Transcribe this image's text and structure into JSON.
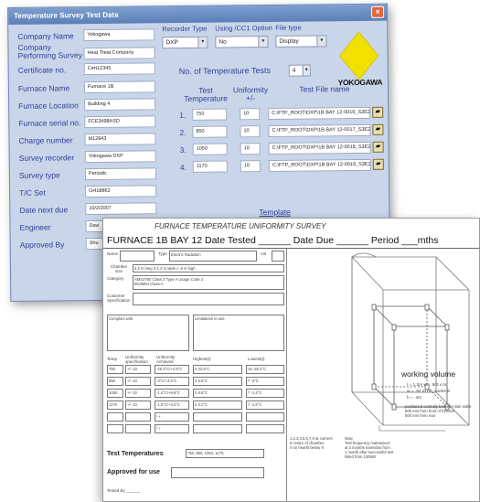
{
  "dialog": {
    "title": "Temperature Survey Test Data",
    "close_glyph": "×",
    "fields": [
      {
        "label": "Company Name",
        "value": "Yokogawa"
      },
      {
        "label": "Company\nPerforming Survey",
        "value": "Heat Treat Company"
      },
      {
        "label": "Certificate no.",
        "value": "Cert12345"
      },
      {
        "label": "Furnace Name",
        "value": "Furnace 1B"
      },
      {
        "label": "Furnace Location",
        "value": "Building 4"
      },
      {
        "label": "Furnace serial no.",
        "value": "FCE3498ASD"
      },
      {
        "label": "Charge number",
        "value": "M12843"
      },
      {
        "label": "Survey recorder",
        "value": "Yokogawa DXP"
      },
      {
        "label": "Survey type",
        "value": "Periodic"
      },
      {
        "label": "T/C Set",
        "value": "GH18862"
      },
      {
        "label": "Date next due",
        "value": "10/2/2007"
      },
      {
        "label": "Engineer",
        "value": "Davi"
      },
      {
        "label": "Approved By",
        "value": "Shu"
      }
    ],
    "recorder_type": {
      "header": "Recorder Type",
      "value": "DXP"
    },
    "cc_option": {
      "header": "Using /CC1 Option",
      "value": "No"
    },
    "file_type": {
      "header": "File type",
      "value": "Display"
    },
    "num_tests": {
      "label": "No. of Temperature Tests",
      "value": "4"
    },
    "columns": {
      "test_temp": "Test\nTemperature",
      "uniformity": "Uniformity\n+/-",
      "file_name": "Test File name"
    },
    "tests": [
      {
        "num": "1.",
        "temp": "750",
        "uniformity": "10",
        "file": "C:\\FTP_ROOT\\DXP\\1B BAY 12-0016_S3E20"
      },
      {
        "num": "2.",
        "temp": "850",
        "uniformity": "10",
        "file": "C:\\FTP_ROOT\\DXP\\1B BAY 12-0017_S3E20"
      },
      {
        "num": "3.",
        "temp": "1050",
        "uniformity": "10",
        "file": "C:\\FTP_ROOT\\DXP\\1B BAY 12-0018_S3E20"
      },
      {
        "num": "4.",
        "temp": "1170",
        "uniformity": "10",
        "file": "C:\\FTP_ROOT\\DXP\\1B BAY 12-0019_S3E20"
      }
    ],
    "template_label": "Template",
    "logo_text": "YOKOGAWA",
    "logo_color": "#f2e000"
  },
  "sheet": {
    "title": "FURNACE TEMPERATURE UNIFORMITY SURVEY",
    "heading": "FURNACE  1B    BAY  12      Date Tested ______   Date Due ______   Period ___mths",
    "name_label": "Name",
    "type_label": "Type",
    "type_value": "Electric   Radiation",
    "vol_label": "Vol",
    "chamber_label": "Chamber\nsize",
    "chamber_value": "3.2 m long  X 1.3 m wide  x .8 m high",
    "category_label": "Category",
    "category_value": "AMS2750  Class 3  Type A  Usage Code 2\nBS2M54  Class A",
    "customer_label": "Customer\nSpecification",
    "complies_label": "Complies with",
    "limitations_label": "Limitations to use",
    "table_headers": [
      "Temp",
      "Uniformity\nspecification",
      "Uniformity\nAchieved",
      "Highest(t)",
      "Lowest(t)"
    ],
    "table_rows": [
      [
        "750",
        "+/-  10",
        "-26.3°C/+4.9°C",
        "2  22.8°C",
        "16  -26.3°C"
      ],
      [
        "850",
        "+/-  10",
        "-3°C/+3.6°C",
        "2  3.6°C",
        "7  -3°C"
      ],
      [
        "1050",
        "+/-  10",
        "-1.4°C/+6.6°C",
        "2  6.6°C",
        "7  -1.4°C"
      ],
      [
        "1170",
        "+/-  10",
        "-1.8°C/+3.2°C",
        "2  3.2°C",
        "7  -1.8°C"
      ],
      [
        "",
        "",
        "/ +",
        "",
        ""
      ],
      [
        "",
        "",
        "/ +",
        "",
        ""
      ]
    ],
    "test_temps_label": "Test Temperatures",
    "test_temps_value": "750, 850, 1050, 1170,",
    "approved_label": "Approved for use",
    "tested_by_label": "Tested By ______",
    "tc_note": "1,2,3,4,5,6,7,8 at corners\n9 centre of chamber\n0 on hearth below 9",
    "note_text": "Note\nTest frequency  maintained\nat 3 months  extended from\n1 month after successful  test\nlisted from  130592",
    "working_volume": "working volume",
    "formula": "l = 1.2m    w= .9/0.x.m\nw = .92 m    no. works 9\nh = .4m",
    "positioned": "positioned centrally between side walls\n500 mm from front of furnace\n500 mm from rear"
  }
}
